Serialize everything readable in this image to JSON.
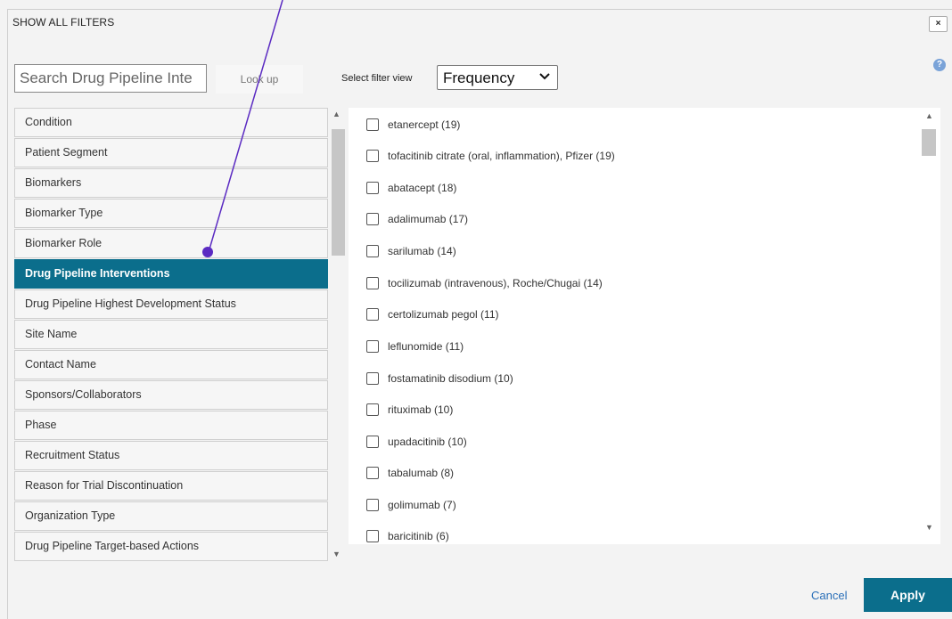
{
  "dialog": {
    "title": "SHOW ALL FILTERS",
    "close_symbol": "×",
    "help_symbol": "?"
  },
  "search": {
    "placeholder": "Search Drug Pipeline Inte",
    "lookup_label": "Look up"
  },
  "filter_view": {
    "label": "Select filter view",
    "selected": "Frequency"
  },
  "categories": [
    {
      "label": "Condition",
      "active": false
    },
    {
      "label": "Patient Segment",
      "active": false
    },
    {
      "label": "Biomarkers",
      "active": false
    },
    {
      "label": "Biomarker Type",
      "active": false
    },
    {
      "label": "Biomarker Role",
      "active": false
    },
    {
      "label": "Drug Pipeline Interventions",
      "active": true
    },
    {
      "label": "Drug Pipeline Highest Development Status",
      "active": false
    },
    {
      "label": "Site Name",
      "active": false
    },
    {
      "label": "Contact Name",
      "active": false
    },
    {
      "label": "Sponsors/Collaborators",
      "active": false
    },
    {
      "label": "Phase",
      "active": false
    },
    {
      "label": "Recruitment Status",
      "active": false
    },
    {
      "label": "Reason for Trial Discontinuation",
      "active": false
    },
    {
      "label": "Organization Type",
      "active": false
    },
    {
      "label": "Drug Pipeline Target-based Actions",
      "active": false
    }
  ],
  "options": [
    {
      "label": "etanercept (19)",
      "checked": false
    },
    {
      "label": "tofacitinib citrate (oral, inflammation), Pfizer (19)",
      "checked": false
    },
    {
      "label": "abatacept (18)",
      "checked": false
    },
    {
      "label": "adalimumab (17)",
      "checked": false
    },
    {
      "label": "sarilumab (14)",
      "checked": false
    },
    {
      "label": "tocilizumab (intravenous), Roche/Chugai (14)",
      "checked": false
    },
    {
      "label": "certolizumab pegol (11)",
      "checked": false
    },
    {
      "label": "leflunomide (11)",
      "checked": false
    },
    {
      "label": "fostamatinib disodium (10)",
      "checked": false
    },
    {
      "label": "rituximab (10)",
      "checked": false
    },
    {
      "label": "upadacitinib (10)",
      "checked": false
    },
    {
      "label": "tabalumab (8)",
      "checked": false
    },
    {
      "label": "golimumab (7)",
      "checked": false
    },
    {
      "label": "baricitinib (6)",
      "checked": false
    }
  ],
  "actions": {
    "cancel_label": "Cancel",
    "apply_label": "Apply"
  },
  "colors": {
    "accent": "#0b6e8c",
    "annotation": "#5b2bc2"
  }
}
